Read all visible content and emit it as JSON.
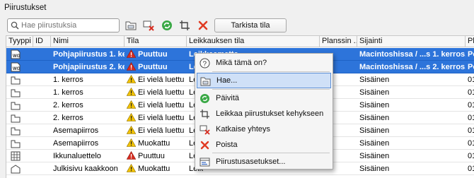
{
  "window": {
    "title": "Piirustukset"
  },
  "toolbar": {
    "search_placeholder": "Hae piirustuksia",
    "check_button": "Tarkista tila"
  },
  "columns": [
    "Tyyppi",
    "ID",
    "Nimi",
    "Tila",
    "Leikkauksen tila",
    "Planssin ...",
    "Sijainti",
    "Pl"
  ],
  "rows": [
    {
      "icon": "wall-icon",
      "name": "Pohjapiirustus 1. ker...",
      "status_icon": "error",
      "status": "Puuttuu",
      "cut": "Leikkaamatta",
      "plan": "",
      "location": "Macintoshissa / ...s 1. kerros.dwg",
      "pl": "Po",
      "selected": true
    },
    {
      "icon": "wall-icon",
      "name": "Pohjapiirustus 2. ker...",
      "status_icon": "error",
      "status": "Puuttuu",
      "cut": "Leikkaamatta",
      "plan": "",
      "location": "Macintoshissa / ...s 2. kerros.dwg",
      "pl": "Po",
      "selected": true
    },
    {
      "icon": "floorplan-icon",
      "name": "1. kerros",
      "status_icon": "warning",
      "status": "Ei vielä luettu",
      "cut": "Leik",
      "plan": "",
      "location": "Sisäinen",
      "pl": "01",
      "selected": false
    },
    {
      "icon": "floorplan-icon",
      "name": "1. kerros",
      "status_icon": "warning",
      "status": "Ei vielä luettu",
      "cut": "Leik",
      "plan": "",
      "location": "Sisäinen",
      "pl": "01",
      "selected": false
    },
    {
      "icon": "floorplan-icon",
      "name": "2. kerros",
      "status_icon": "warning",
      "status": "Ei vielä luettu",
      "cut": "Leik",
      "plan": "",
      "location": "Sisäinen",
      "pl": "01",
      "selected": false
    },
    {
      "icon": "floorplan-icon",
      "name": "2. kerros",
      "status_icon": "warning",
      "status": "Ei vielä luettu",
      "cut": "Leik",
      "plan": "",
      "location": "Sisäinen",
      "pl": "01",
      "selected": false
    },
    {
      "icon": "floorplan-icon",
      "name": "Asemapiirros",
      "status_icon": "warning",
      "status": "Ei vielä luettu",
      "cut": "Leik",
      "plan": "",
      "location": "Sisäinen",
      "pl": "01",
      "selected": false
    },
    {
      "icon": "floorplan-icon",
      "name": "Asemapiirros",
      "status_icon": "warning",
      "status": "Muokattu",
      "cut": "Leik",
      "plan": "",
      "location": "Sisäinen",
      "pl": "01",
      "selected": false
    },
    {
      "icon": "grid-icon",
      "name": "Ikkunaluettelo",
      "status_icon": "error",
      "status": "Puuttuu",
      "cut": "Leik",
      "plan": "",
      "location": "Sisäinen",
      "pl": "01",
      "selected": false
    },
    {
      "icon": "elevation-icon",
      "name": "Julkisivu kaakkoon",
      "status_icon": "warning",
      "status": "Muokattu",
      "cut": "Leik",
      "plan": "",
      "location": "Sisäinen",
      "pl": "01",
      "selected": false
    }
  ],
  "context_menu": [
    {
      "label": "Mikä tämä on?",
      "icon": "help-icon",
      "highlight": false
    },
    {
      "label": "Hae...",
      "icon": "browse-folder-icon",
      "highlight": true
    },
    {
      "label": "Päivitä",
      "icon": "refresh-icon",
      "highlight": false
    },
    {
      "label": "Leikkaa piirustukset kehykseen",
      "icon": "crop-icon",
      "highlight": false
    },
    {
      "label": "Katkaise yhteys",
      "icon": "unlink-icon",
      "highlight": false
    },
    {
      "label": "Poista",
      "icon": "delete-icon",
      "highlight": false
    },
    {
      "label": "Piirustusasetukset...",
      "icon": "settings-icon",
      "highlight": false
    }
  ],
  "colors": {
    "selection": "#2d74da",
    "error": "#d62b1f",
    "warning": "#f2c200",
    "menu_highlight": "#cfe0f7"
  }
}
